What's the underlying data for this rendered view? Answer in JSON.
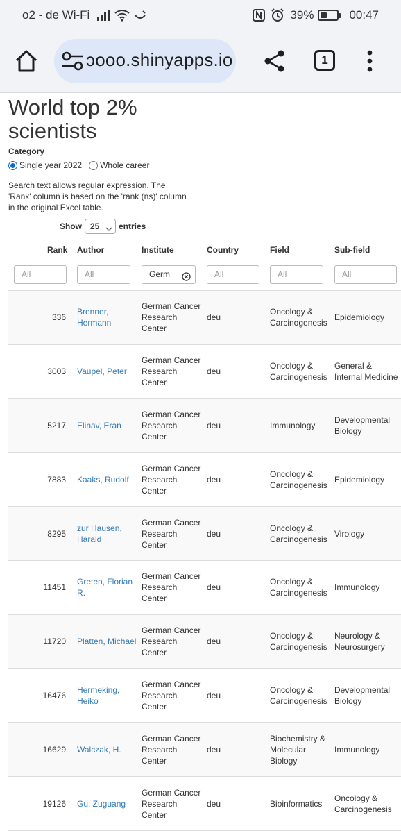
{
  "status_bar": {
    "carrier": "o2 - de Wi-Fi",
    "battery": "39%",
    "battery_level": 0.39,
    "time": "00:47"
  },
  "browser": {
    "url": "ɔooo.shinyapps.io",
    "tab_count": "1"
  },
  "page": {
    "title": "World top 2% scientists",
    "category_label": "Category",
    "radio_options": [
      {
        "label": "Single year 2022",
        "checked": true
      },
      {
        "label": "Whole career",
        "checked": false
      }
    ],
    "help_text": "Search text allows regular expression. The 'Rank' column is based on the 'rank (ns)' column in the original Excel table.",
    "show_label": "Show",
    "entries_value": "25",
    "entries_label": "entries"
  },
  "table": {
    "columns": [
      "Rank",
      "Author",
      "Institute",
      "Country",
      "Field",
      "Sub-field"
    ],
    "filters": [
      {
        "placeholder": "All",
        "value": ""
      },
      {
        "placeholder": "All",
        "value": ""
      },
      {
        "placeholder": "All",
        "value": "Germ"
      },
      {
        "placeholder": "All",
        "value": ""
      },
      {
        "placeholder": "All",
        "value": ""
      },
      {
        "placeholder": "All",
        "value": ""
      }
    ],
    "rows": [
      {
        "rank": "336",
        "author": "Brenner, Hermann",
        "institute": "German Cancer Research Center",
        "country": "deu",
        "field": "Oncology & Carcinogenesis",
        "subfield": "Epidemiology"
      },
      {
        "rank": "3003",
        "author": "Vaupel, Peter",
        "institute": "German Cancer Research Center",
        "country": "deu",
        "field": "Oncology & Carcinogenesis",
        "subfield": "General & Internal Medicine"
      },
      {
        "rank": "5217",
        "author": "Elinav, Eran",
        "institute": "German Cancer Research Center",
        "country": "deu",
        "field": "Immunology",
        "subfield": "Developmental Biology"
      },
      {
        "rank": "7883",
        "author": "Kaaks, Rudolf",
        "institute": "German Cancer Research Center",
        "country": "deu",
        "field": "Oncology & Carcinogenesis",
        "subfield": "Epidemiology"
      },
      {
        "rank": "8295",
        "author": "zur Hausen, Harald",
        "institute": "German Cancer Research Center",
        "country": "deu",
        "field": "Oncology & Carcinogenesis",
        "subfield": "Virology"
      },
      {
        "rank": "11451",
        "author": "Greten, Florian R.",
        "institute": "German Cancer Research Center",
        "country": "deu",
        "field": "Oncology & Carcinogenesis",
        "subfield": "Immunology"
      },
      {
        "rank": "11720",
        "author": "Platten, Michael",
        "institute": "German Cancer Research Center",
        "country": "deu",
        "field": "Oncology & Carcinogenesis",
        "subfield": "Neurology & Neurosurgery"
      },
      {
        "rank": "16476",
        "author": "Hermeking, Heiko",
        "institute": "German Cancer Research Center",
        "country": "deu",
        "field": "Oncology & Carcinogenesis",
        "subfield": "Developmental Biology"
      },
      {
        "rank": "16629",
        "author": "Walczak, H.",
        "institute": "German Cancer Research Center",
        "country": "deu",
        "field": "Biochemistry & Molecular Biology",
        "subfield": "Immunology"
      },
      {
        "rank": "19126",
        "author": "Gu, Zuguang",
        "institute": "German Cancer Research Center",
        "country": "deu",
        "field": "Bioinformatics",
        "subfield": "Oncology & Carcinogenesis"
      }
    ]
  },
  "colors": {
    "link": "#337ab7",
    "radio_accent": "#0b6fd1",
    "url_pill": "#dde7f7",
    "chrome_bg": "#f1f3f6"
  },
  "icons": [
    "signal-icon",
    "wifi-icon",
    "nfc-icon",
    "alarm-icon",
    "battery-icon",
    "home-icon",
    "site-settings-icon",
    "share-icon",
    "tabs-icon",
    "more-vert-icon",
    "chevron-down-icon",
    "clear-icon"
  ]
}
